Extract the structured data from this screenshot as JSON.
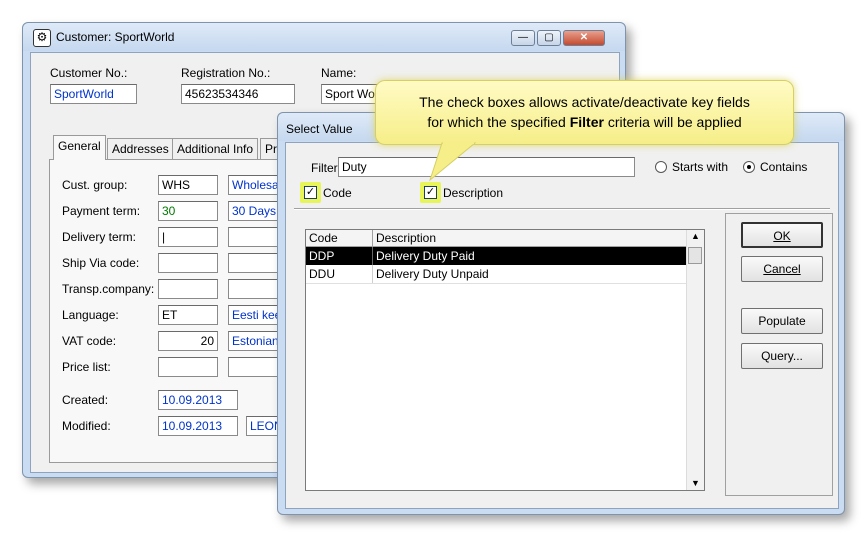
{
  "customer_window": {
    "title": "Customer: SportWorld",
    "header": {
      "customer_no_label": "Customer No.:",
      "customer_no_value": "SportWorld",
      "registration_no_label": "Registration No.:",
      "registration_no_value": "45623534346",
      "name_label": "Name:",
      "name_value": "Sport Wor"
    },
    "tabs": [
      "General",
      "Addresses",
      "Additional Info",
      "Pr"
    ],
    "fields": {
      "cust_group_label": "Cust. group:",
      "cust_group_code": "WHS",
      "cust_group_desc": "Wholesa",
      "payment_term_label": "Payment term:",
      "payment_term_code": "30",
      "payment_term_desc": "30 Days",
      "delivery_term_label": "Delivery term:",
      "ship_via_label": "Ship Via code:",
      "transp_company_label": "Transp.company:",
      "language_label": "Language:",
      "language_code": "ET",
      "language_desc": "Eesti kee",
      "vat_code_label": "VAT code:",
      "vat_code_value": "20",
      "vat_code_desc": "Estonian",
      "price_list_label": "Price list:",
      "created_label": "Created:",
      "created_value": "10.09.2013",
      "modified_label": "Modified:",
      "modified_value": "10.09.2013",
      "modified_user": "LEON"
    }
  },
  "select_window": {
    "title": "Select Value",
    "filter_label": "Filter:",
    "filter_value": "Duty",
    "starts_with_label": "Starts with",
    "contains_label": "Contains",
    "code_checkbox_label": "Code",
    "description_checkbox_label": "Description",
    "columns": [
      "Code",
      "Description"
    ],
    "rows": [
      {
        "code": "DDP",
        "description": "Delivery Duty Paid"
      },
      {
        "code": "DDU",
        "description": "Delivery Duty Unpaid"
      }
    ],
    "buttons": {
      "ok": "OK",
      "cancel": "Cancel",
      "populate": "Populate",
      "query": "Query..."
    }
  },
  "callout": {
    "line1": "The check boxes allows activate/deactivate key fields",
    "line2_pre": "for which the specified ",
    "line2_bold": "Filter",
    "line2_post": " criteria will be applied"
  },
  "colors": {
    "highlight": "#e8f558",
    "callout_bg": "#fdf7a3",
    "selected_row": "#000000",
    "link_blue": "#0033cc"
  }
}
